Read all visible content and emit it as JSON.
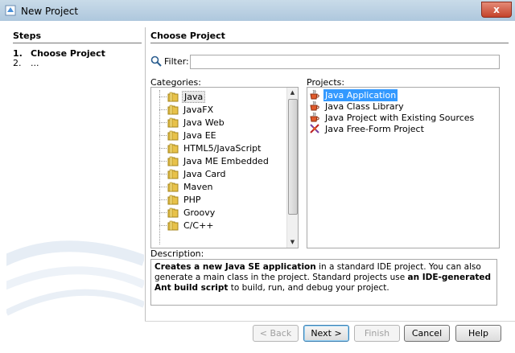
{
  "window": {
    "title": "New Project",
    "close": "x"
  },
  "steps": {
    "heading": "Steps",
    "items": [
      {
        "num": "1.",
        "label": "Choose Project"
      },
      {
        "num": "2.",
        "label": "..."
      }
    ]
  },
  "main": {
    "heading": "Choose Project",
    "filter_label": "Filter:",
    "filter_value": "",
    "categories_label": "Categories:",
    "projects_label": "Projects:",
    "categories": [
      "Java",
      "JavaFX",
      "Java Web",
      "Java EE",
      "HTML5/JavaScript",
      "Java ME Embedded",
      "Java Card",
      "Maven",
      "PHP",
      "Groovy",
      "C/C++"
    ],
    "projects": [
      "Java Application",
      "Java Class Library",
      "Java Project with Existing Sources",
      "Java Free-Form Project"
    ],
    "description_label": "Description:",
    "description": {
      "b1": "Creates a new Java SE application",
      "t1": " in a standard IDE project. You can also generate a main class in the project. Standard projects use ",
      "b2": "an IDE-generated Ant build script",
      "t2": " to build, run, and debug your project."
    }
  },
  "buttons": {
    "back": "< Back",
    "next": "Next >",
    "finish": "Finish",
    "cancel": "Cancel",
    "help": "Help"
  },
  "colors": {
    "selection": "#3399ff",
    "titlebar": "#b9cfe3",
    "close": "#c4432b"
  }
}
